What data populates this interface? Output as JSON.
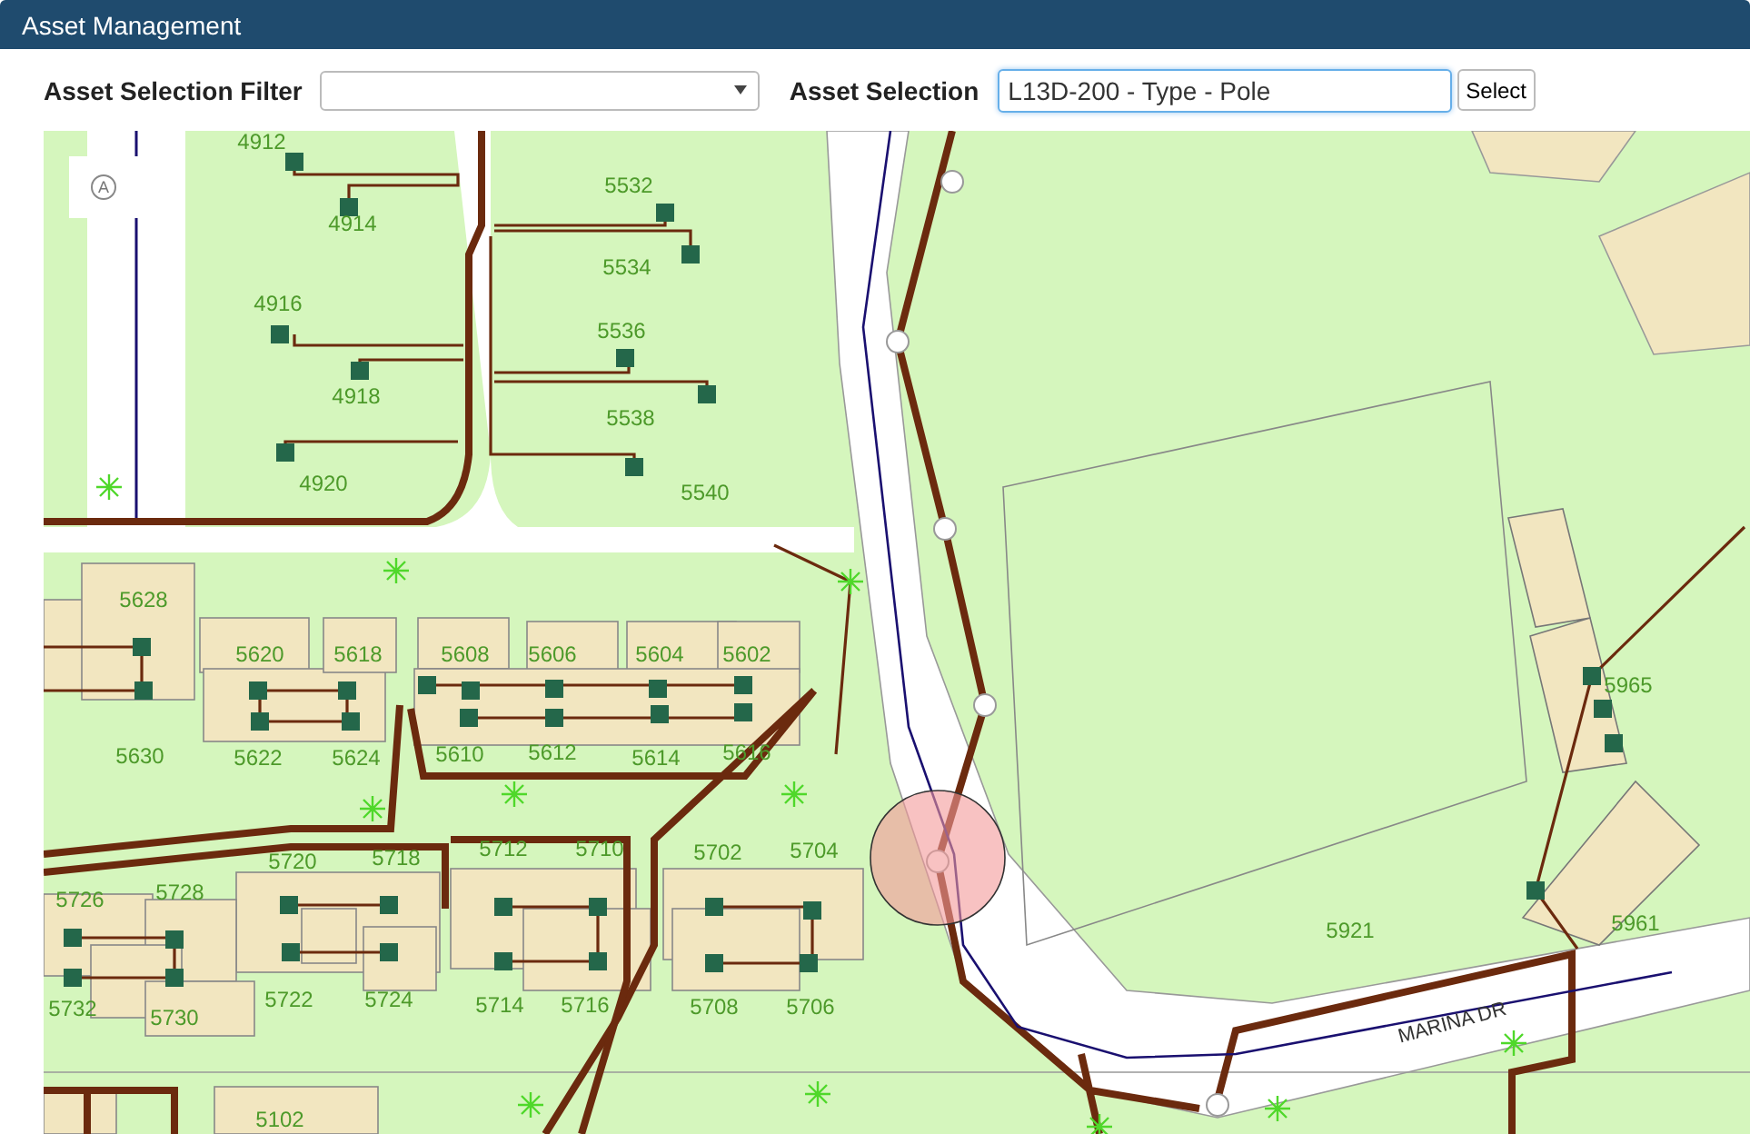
{
  "header": {
    "title": "Asset Management"
  },
  "toolbar": {
    "filter_label": "Asset Selection Filter",
    "selection_label": "Asset Selection",
    "selection_value": "L13D-200 - Type - Pole",
    "select_button": "Select"
  },
  "map": {
    "control": "A",
    "parcel_labels": [
      "4912",
      "4914",
      "4916",
      "4918",
      "4920",
      "5532",
      "5534",
      "5536",
      "5538",
      "5540",
      "5628",
      "5620",
      "5618",
      "5608",
      "5606",
      "5604",
      "5602",
      "5630",
      "5622",
      "5624",
      "5610",
      "5612",
      "5614",
      "5616",
      "5720",
      "5718",
      "5712",
      "5710",
      "5702",
      "5704",
      "5726",
      "5728",
      "5732",
      "5730",
      "5722",
      "5724",
      "5714",
      "5716",
      "5708",
      "5706",
      "5102",
      "5921",
      "5965",
      "5961"
    ],
    "street_labels": [
      "MARINA DR"
    ]
  }
}
